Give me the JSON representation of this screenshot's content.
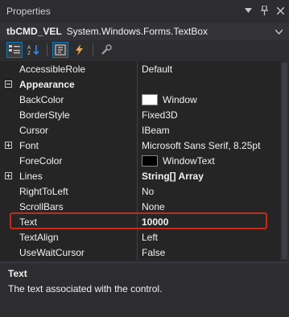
{
  "window": {
    "title": "Properties"
  },
  "object": {
    "name": "tbCMD_VEL",
    "type": "System.Windows.Forms.TextBox"
  },
  "toolbar": {
    "icons": [
      "categorized-icon",
      "alphabetical-icon",
      "properties-icon",
      "events-icon",
      "property-pages-icon"
    ]
  },
  "rows": [
    {
      "name": "AccessibleRole",
      "value": "Default"
    },
    {
      "name": "Appearance",
      "category": true
    },
    {
      "name": "BackColor",
      "value": "Window",
      "swatch": "#ffffff"
    },
    {
      "name": "BorderStyle",
      "value": "Fixed3D"
    },
    {
      "name": "Cursor",
      "value": "IBeam"
    },
    {
      "name": "Font",
      "value": "Microsoft Sans Serif, 8.25pt",
      "expandable": true
    },
    {
      "name": "ForeColor",
      "value": "WindowText",
      "swatch": "#000000"
    },
    {
      "name": "Lines",
      "value": "String[] Array",
      "expandable": true,
      "bold": true
    },
    {
      "name": "RightToLeft",
      "value": "No"
    },
    {
      "name": "ScrollBars",
      "value": "None"
    },
    {
      "name": "Text",
      "value": "10000",
      "bold": true,
      "highlighted": true
    },
    {
      "name": "TextAlign",
      "value": "Left"
    },
    {
      "name": "UseWaitCursor",
      "value": "False"
    }
  ],
  "description": {
    "title": "Text",
    "text": "The text associated with the control."
  },
  "colors": {
    "accent": "#007acc",
    "highlight_border": "#c42b1c"
  }
}
